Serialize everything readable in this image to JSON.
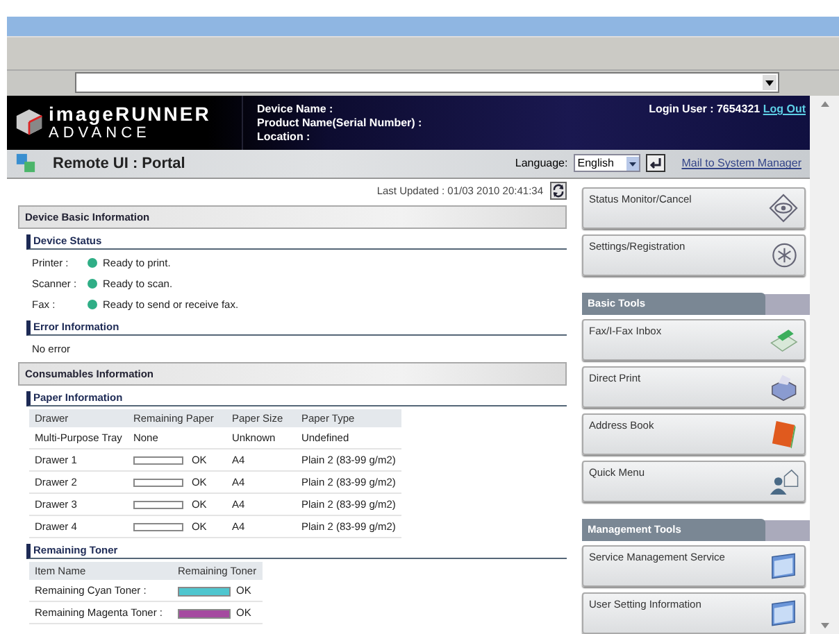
{
  "header": {
    "logo_line1": "imageRUNNER",
    "logo_line2": "ADVANCE",
    "device_fields": [
      "Device Name :",
      "Product Name(Serial Number) :",
      "Location :"
    ],
    "login_user": "Login User : 7654321",
    "logout": "Log Out"
  },
  "subheader": {
    "title": "Remote UI : Portal",
    "language_label": "Language:",
    "language_value": "English",
    "mail_link": "Mail to System Manager"
  },
  "last_updated": "Last Updated : 01/03 2010 20:41:34",
  "device_basic": {
    "title": "Device Basic Information",
    "status_title": "Device Status",
    "status_rows": [
      {
        "label": "Printer :",
        "text": "Ready to print.",
        "color": "#2fae86"
      },
      {
        "label": "Scanner :",
        "text": "Ready to scan.",
        "color": "#2fae86"
      },
      {
        "label": "Fax :",
        "text": "Ready to send or receive fax.",
        "color": "#2fae86"
      }
    ],
    "error_title": "Error Information",
    "error_text": "No error"
  },
  "consumables": {
    "title": "Consumables Information",
    "paper_title": "Paper Information",
    "paper_columns": [
      "Drawer",
      "Remaining Paper",
      "Paper Size",
      "Paper Type"
    ],
    "paper_rows": [
      {
        "drawer": "Multi-Purpose Tray",
        "kind": "text",
        "remaining": "None",
        "size": "Unknown",
        "type": "Undefined"
      },
      {
        "drawer": "Drawer 1",
        "kind": "gauge",
        "remaining": "OK",
        "size": "A4",
        "type": "Plain 2 (83-99 g/m2)"
      },
      {
        "drawer": "Drawer 2",
        "kind": "gauge",
        "remaining": "OK",
        "size": "A4",
        "type": "Plain 2 (83-99 g/m2)"
      },
      {
        "drawer": "Drawer 3",
        "kind": "gauge",
        "remaining": "OK",
        "size": "A4",
        "type": "Plain 2 (83-99 g/m2)"
      },
      {
        "drawer": "Drawer 4",
        "kind": "gauge",
        "remaining": "OK",
        "size": "A4",
        "type": "Plain 2 (83-99 g/m2)"
      }
    ],
    "toner_title": "Remaining Toner",
    "toner_columns": [
      "Item Name",
      "Remaining Toner"
    ],
    "toner_rows": [
      {
        "name": "Remaining Cyan Toner :",
        "color": "#4fc6cf",
        "level": 1,
        "status": "OK"
      },
      {
        "name": "Remaining Magenta Toner :",
        "color": "#a54aa0",
        "level": 1,
        "status": "OK"
      }
    ]
  },
  "side_top": [
    {
      "label": "Status Monitor/Cancel",
      "kind": "status"
    },
    {
      "label": "Settings/Registration",
      "kind": "settings"
    }
  ],
  "side_sections": [
    {
      "title": "Basic Tools",
      "buttons": [
        {
          "label": "Fax/I-Fax Inbox",
          "kind": "inbox"
        },
        {
          "label": "Direct Print",
          "kind": "print"
        },
        {
          "label": "Address Book",
          "kind": "addressbook"
        },
        {
          "label": "Quick Menu",
          "kind": "quickmenu"
        }
      ]
    },
    {
      "title": "Management Tools",
      "buttons": [
        {
          "label": "Service Management Service",
          "kind": "service"
        },
        {
          "label": "User Setting Information",
          "kind": "service"
        }
      ]
    }
  ]
}
